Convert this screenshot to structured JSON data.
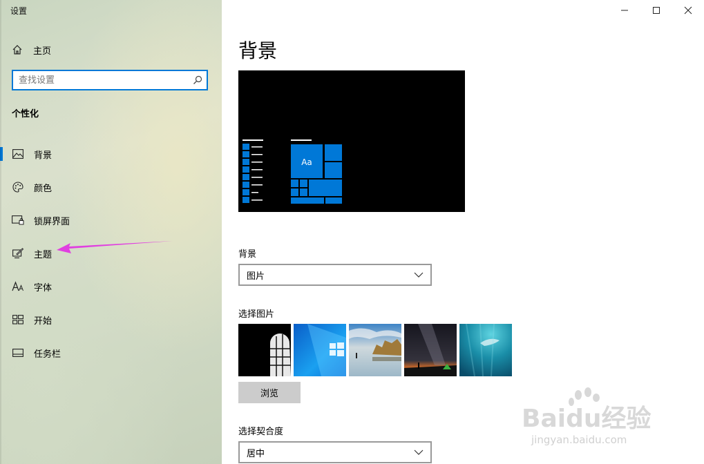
{
  "window": {
    "title": "设置"
  },
  "sidebar": {
    "home_label": "主页",
    "search_placeholder": "查找设置",
    "section_title": "个性化",
    "items": [
      {
        "label": "背景",
        "icon": "picture-icon",
        "active": true
      },
      {
        "label": "颜色",
        "icon": "palette-icon"
      },
      {
        "label": "锁屏界面",
        "icon": "lock-screen-icon"
      },
      {
        "label": "主题",
        "icon": "theme-brush-icon"
      },
      {
        "label": "字体",
        "icon": "font-icon"
      },
      {
        "label": "开始",
        "icon": "start-grid-icon"
      },
      {
        "label": "任务栏",
        "icon": "taskbar-icon"
      }
    ]
  },
  "main": {
    "page_title": "背景",
    "preview": {
      "tile_text": "Aa"
    },
    "background_label": "背景",
    "background_value": "图片",
    "choose_picture_label": "选择图片",
    "browse_label": "浏览",
    "fit_label": "选择契合度",
    "fit_value": "居中"
  },
  "watermark": {
    "line1": "Baidu经验",
    "line2": "jingyan.baidu.com"
  },
  "colors": {
    "accent": "#0078d7",
    "annotation_arrow": "#e040e0"
  }
}
